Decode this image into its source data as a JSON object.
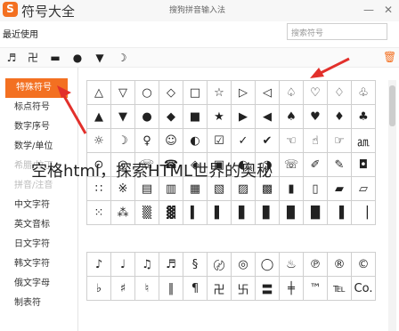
{
  "app": {
    "title": "符号大全",
    "ime": "搜狗拼音输入法",
    "logo_text": "S"
  },
  "window_buttons": [
    "—",
    "✕"
  ],
  "recent": {
    "label": "最近使用",
    "search_placeholder": "搜索符号",
    "symbols": [
      "♬",
      "卍",
      "▬",
      "●",
      "▼",
      "☽"
    ]
  },
  "sidebar": {
    "categories": [
      "特殊符号",
      "标点符号",
      "数字序号",
      "数学/单位",
      "希腊/拉丁",
      "拼音/注音",
      "中文字符",
      "英文音标",
      "日文字符",
      "韩文字符",
      "俄文字母",
      "制表符"
    ],
    "active_index": 0
  },
  "grid_top": [
    [
      "△",
      "▽",
      "○",
      "◇",
      "□",
      "☆",
      "▷",
      "◁",
      "♤",
      "♡",
      "♢",
      "♧"
    ],
    [
      "▲",
      "▼",
      "●",
      "◆",
      "■",
      "★",
      "▶",
      "◀",
      "♠",
      "♥",
      "♦",
      "♣"
    ],
    [
      "☼",
      "☽",
      "♀",
      "☺",
      "◐",
      "☑",
      "✓",
      "✔",
      "☜",
      "☝",
      "☞",
      "㏂"
    ],
    [
      "⊙",
      "◎",
      "☏",
      "☎",
      "◈",
      "▣",
      "◐",
      "◑",
      "☏",
      "✐",
      "✎",
      "◘"
    ],
    [
      "∷",
      "※",
      "▤",
      "▥",
      "▦",
      "▧",
      "▨",
      "▩",
      "▮",
      "▯",
      "▰",
      "▱"
    ],
    [
      "⁙",
      "⁂",
      "▒",
      "▓",
      "▍",
      "▌",
      "▋",
      "▊",
      "▉",
      "█",
      "▐",
      "▕"
    ]
  ],
  "grid_bottom": [
    [
      "♪",
      "♩",
      "♫",
      "♬",
      "§",
      "〄",
      "◎",
      "◯",
      "♨",
      "℗",
      "®",
      "©"
    ],
    [
      "♭",
      "♯",
      "♮",
      "‖",
      "¶",
      "卍",
      "卐",
      "〓",
      "╪",
      "™",
      "℡",
      "Co."
    ]
  ],
  "overlay": "空格html，探索HTML世界的奥秘"
}
